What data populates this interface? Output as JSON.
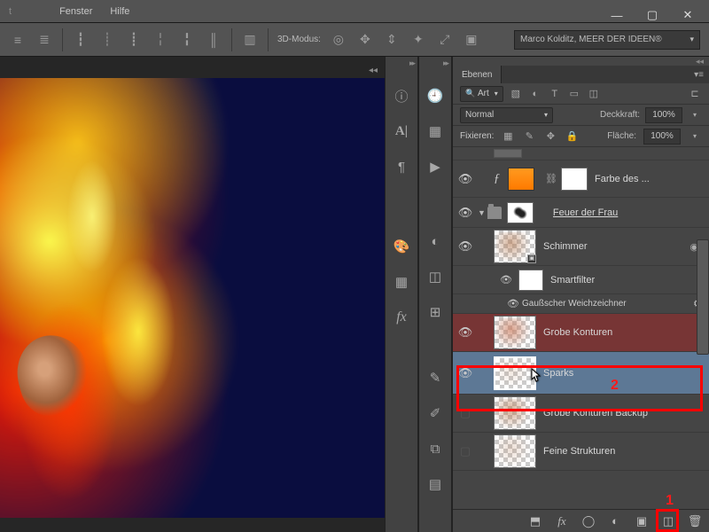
{
  "menu": {
    "fenster": "Fenster",
    "hilfe": "Hilfe"
  },
  "options": {
    "mode3d_label": "3D-Modus:",
    "user_dropdown": "Marco Kolditz, MEER DER IDEEN®"
  },
  "layerspanel": {
    "tab_label": "Ebenen",
    "filter_kind": "Art",
    "blend_mode": "Normal",
    "opacity_label": "Deckkraft:",
    "opacity_value": "100%",
    "lock_label": "Fixieren:",
    "fill_label": "Fläche:",
    "fill_value": "100%"
  },
  "layers": {
    "fill_layer": "Farbe des ...",
    "group_feuer": "Feuer der Frau",
    "schimmer": "Schimmer",
    "smartfilter": "Smartfilter",
    "gauss": "Gaußscher Weichzeichner",
    "grobe": "Grobe Konturen",
    "sparks": "Sparks",
    "grobe_backup": "Grobe Konturen Backup",
    "feine": "Feine Strukturen"
  },
  "annotations": {
    "one": "1",
    "two": "2"
  }
}
